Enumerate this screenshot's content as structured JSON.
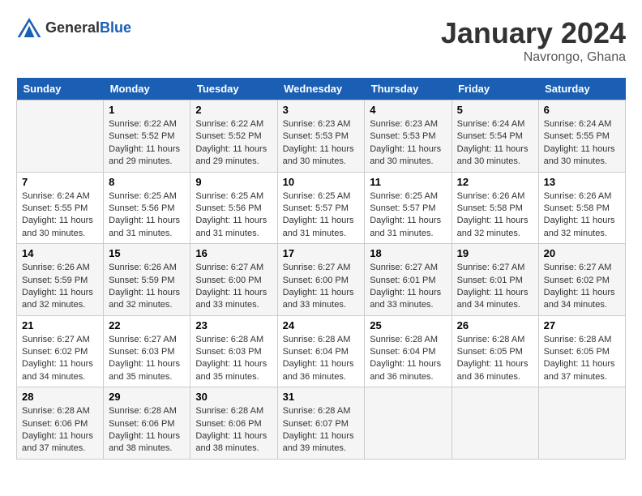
{
  "logo": {
    "general": "General",
    "blue": "Blue"
  },
  "title": "January 2024",
  "location": "Navrongo, Ghana",
  "weekdays": [
    "Sunday",
    "Monday",
    "Tuesday",
    "Wednesday",
    "Thursday",
    "Friday",
    "Saturday"
  ],
  "weeks": [
    [
      {
        "day": "",
        "sunrise": "",
        "sunset": "",
        "daylight": ""
      },
      {
        "day": "1",
        "sunrise": "Sunrise: 6:22 AM",
        "sunset": "Sunset: 5:52 PM",
        "daylight": "Daylight: 11 hours and 29 minutes."
      },
      {
        "day": "2",
        "sunrise": "Sunrise: 6:22 AM",
        "sunset": "Sunset: 5:52 PM",
        "daylight": "Daylight: 11 hours and 29 minutes."
      },
      {
        "day": "3",
        "sunrise": "Sunrise: 6:23 AM",
        "sunset": "Sunset: 5:53 PM",
        "daylight": "Daylight: 11 hours and 30 minutes."
      },
      {
        "day": "4",
        "sunrise": "Sunrise: 6:23 AM",
        "sunset": "Sunset: 5:53 PM",
        "daylight": "Daylight: 11 hours and 30 minutes."
      },
      {
        "day": "5",
        "sunrise": "Sunrise: 6:24 AM",
        "sunset": "Sunset: 5:54 PM",
        "daylight": "Daylight: 11 hours and 30 minutes."
      },
      {
        "day": "6",
        "sunrise": "Sunrise: 6:24 AM",
        "sunset": "Sunset: 5:55 PM",
        "daylight": "Daylight: 11 hours and 30 minutes."
      }
    ],
    [
      {
        "day": "7",
        "sunrise": "Sunrise: 6:24 AM",
        "sunset": "Sunset: 5:55 PM",
        "daylight": "Daylight: 11 hours and 30 minutes."
      },
      {
        "day": "8",
        "sunrise": "Sunrise: 6:25 AM",
        "sunset": "Sunset: 5:56 PM",
        "daylight": "Daylight: 11 hours and 31 minutes."
      },
      {
        "day": "9",
        "sunrise": "Sunrise: 6:25 AM",
        "sunset": "Sunset: 5:56 PM",
        "daylight": "Daylight: 11 hours and 31 minutes."
      },
      {
        "day": "10",
        "sunrise": "Sunrise: 6:25 AM",
        "sunset": "Sunset: 5:57 PM",
        "daylight": "Daylight: 11 hours and 31 minutes."
      },
      {
        "day": "11",
        "sunrise": "Sunrise: 6:25 AM",
        "sunset": "Sunset: 5:57 PM",
        "daylight": "Daylight: 11 hours and 31 minutes."
      },
      {
        "day": "12",
        "sunrise": "Sunrise: 6:26 AM",
        "sunset": "Sunset: 5:58 PM",
        "daylight": "Daylight: 11 hours and 32 minutes."
      },
      {
        "day": "13",
        "sunrise": "Sunrise: 6:26 AM",
        "sunset": "Sunset: 5:58 PM",
        "daylight": "Daylight: 11 hours and 32 minutes."
      }
    ],
    [
      {
        "day": "14",
        "sunrise": "Sunrise: 6:26 AM",
        "sunset": "Sunset: 5:59 PM",
        "daylight": "Daylight: 11 hours and 32 minutes."
      },
      {
        "day": "15",
        "sunrise": "Sunrise: 6:26 AM",
        "sunset": "Sunset: 5:59 PM",
        "daylight": "Daylight: 11 hours and 32 minutes."
      },
      {
        "day": "16",
        "sunrise": "Sunrise: 6:27 AM",
        "sunset": "Sunset: 6:00 PM",
        "daylight": "Daylight: 11 hours and 33 minutes."
      },
      {
        "day": "17",
        "sunrise": "Sunrise: 6:27 AM",
        "sunset": "Sunset: 6:00 PM",
        "daylight": "Daylight: 11 hours and 33 minutes."
      },
      {
        "day": "18",
        "sunrise": "Sunrise: 6:27 AM",
        "sunset": "Sunset: 6:01 PM",
        "daylight": "Daylight: 11 hours and 33 minutes."
      },
      {
        "day": "19",
        "sunrise": "Sunrise: 6:27 AM",
        "sunset": "Sunset: 6:01 PM",
        "daylight": "Daylight: 11 hours and 34 minutes."
      },
      {
        "day": "20",
        "sunrise": "Sunrise: 6:27 AM",
        "sunset": "Sunset: 6:02 PM",
        "daylight": "Daylight: 11 hours and 34 minutes."
      }
    ],
    [
      {
        "day": "21",
        "sunrise": "Sunrise: 6:27 AM",
        "sunset": "Sunset: 6:02 PM",
        "daylight": "Daylight: 11 hours and 34 minutes."
      },
      {
        "day": "22",
        "sunrise": "Sunrise: 6:27 AM",
        "sunset": "Sunset: 6:03 PM",
        "daylight": "Daylight: 11 hours and 35 minutes."
      },
      {
        "day": "23",
        "sunrise": "Sunrise: 6:28 AM",
        "sunset": "Sunset: 6:03 PM",
        "daylight": "Daylight: 11 hours and 35 minutes."
      },
      {
        "day": "24",
        "sunrise": "Sunrise: 6:28 AM",
        "sunset": "Sunset: 6:04 PM",
        "daylight": "Daylight: 11 hours and 36 minutes."
      },
      {
        "day": "25",
        "sunrise": "Sunrise: 6:28 AM",
        "sunset": "Sunset: 6:04 PM",
        "daylight": "Daylight: 11 hours and 36 minutes."
      },
      {
        "day": "26",
        "sunrise": "Sunrise: 6:28 AM",
        "sunset": "Sunset: 6:05 PM",
        "daylight": "Daylight: 11 hours and 36 minutes."
      },
      {
        "day": "27",
        "sunrise": "Sunrise: 6:28 AM",
        "sunset": "Sunset: 6:05 PM",
        "daylight": "Daylight: 11 hours and 37 minutes."
      }
    ],
    [
      {
        "day": "28",
        "sunrise": "Sunrise: 6:28 AM",
        "sunset": "Sunset: 6:06 PM",
        "daylight": "Daylight: 11 hours and 37 minutes."
      },
      {
        "day": "29",
        "sunrise": "Sunrise: 6:28 AM",
        "sunset": "Sunset: 6:06 PM",
        "daylight": "Daylight: 11 hours and 38 minutes."
      },
      {
        "day": "30",
        "sunrise": "Sunrise: 6:28 AM",
        "sunset": "Sunset: 6:06 PM",
        "daylight": "Daylight: 11 hours and 38 minutes."
      },
      {
        "day": "31",
        "sunrise": "Sunrise: 6:28 AM",
        "sunset": "Sunset: 6:07 PM",
        "daylight": "Daylight: 11 hours and 39 minutes."
      },
      {
        "day": "",
        "sunrise": "",
        "sunset": "",
        "daylight": ""
      },
      {
        "day": "",
        "sunrise": "",
        "sunset": "",
        "daylight": ""
      },
      {
        "day": "",
        "sunrise": "",
        "sunset": "",
        "daylight": ""
      }
    ]
  ]
}
